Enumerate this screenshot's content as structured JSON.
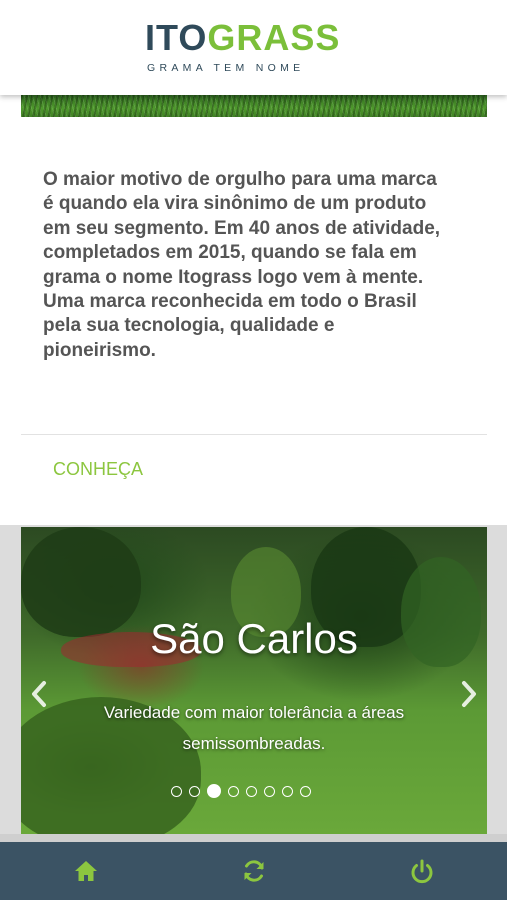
{
  "header": {
    "logo_text_a": "ITO",
    "logo_text_b": "GRASS",
    "tagline": "GRAMA TEM NOME"
  },
  "card": {
    "body": "O maior motivo de orgulho para uma marca é quando ela vira sinônimo de um produto em seu segmento. Em 40 anos de atividade, completados em 2015, quando se fala em grama o nome Itograss logo vem à mente. Uma marca reconhecida em todo o Brasil pela sua tecnologia, qualidade e pioneirismo.",
    "link_label": "CONHEÇA"
  },
  "carousel": {
    "title": "São Carlos",
    "caption": "Variedade com maior tolerância a áreas semissombreadas.",
    "slide_count": 8,
    "active_index": 2
  },
  "bottom_nav": {
    "icons": [
      "home-icon",
      "refresh-icon",
      "power-icon"
    ]
  },
  "colors": {
    "brand_dark": "#2f4a5a",
    "brand_green": "#8cc63f",
    "nav_bar": "#3b5364",
    "body_text": "#555555"
  }
}
